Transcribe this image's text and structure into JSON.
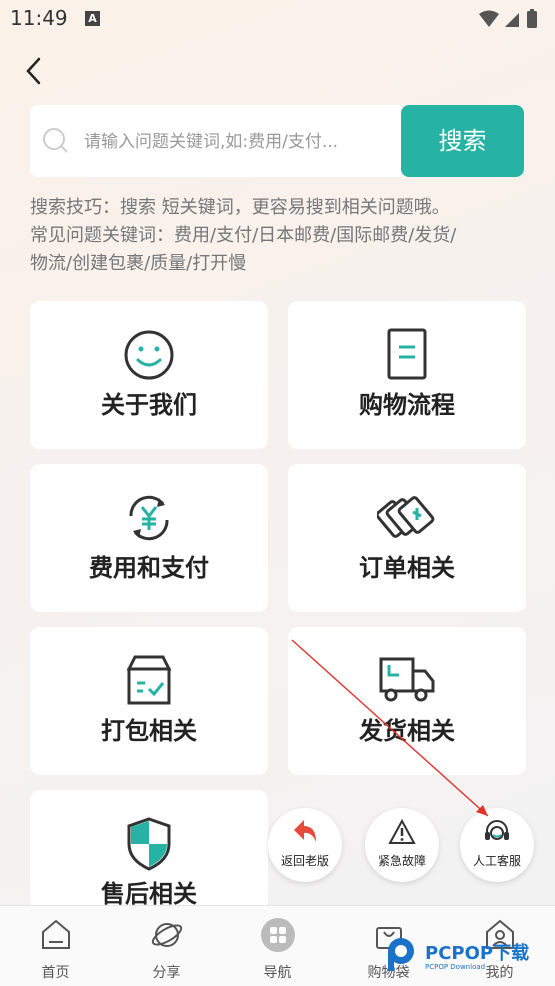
{
  "status_bar": {
    "time": "11:49",
    "notification_letter": "A"
  },
  "search": {
    "placeholder": "请输入问题关键词,如:费用/支付...",
    "button_label": "搜索"
  },
  "tips": {
    "line1": "搜索技巧：搜索 短关键词，更容易搜到相关问题哦。",
    "line2": "常见问题关键词：费用/支付/日本邮费/国际邮费/发货/",
    "line3": "物流/创建包裹/质量/打开慢"
  },
  "cards": [
    {
      "label": "关于我们",
      "icon": "smiley-icon"
    },
    {
      "label": "购物流程",
      "icon": "document-icon"
    },
    {
      "label": "费用和支付",
      "icon": "yen-refresh-icon"
    },
    {
      "label": "订单相关",
      "icon": "cards-icon"
    },
    {
      "label": "打包相关",
      "icon": "box-check-icon"
    },
    {
      "label": "发货相关",
      "icon": "truck-icon"
    },
    {
      "label": "售后相关",
      "icon": "shield-icon"
    }
  ],
  "fabs": [
    {
      "label": "返回老版",
      "icon": "undo-arrow-icon"
    },
    {
      "label": "紧急故障",
      "icon": "warning-icon"
    },
    {
      "label": "人工客服",
      "icon": "headset-icon"
    }
  ],
  "tabs": [
    {
      "label": "首页",
      "icon": "home-icon"
    },
    {
      "label": "分享",
      "icon": "planet-icon"
    },
    {
      "label": "导航",
      "icon": "grid-icon"
    },
    {
      "label": "购物袋",
      "icon": "bag-icon"
    },
    {
      "label": "我的",
      "icon": "user-icon"
    }
  ],
  "watermark": {
    "text": "PCPOP下载",
    "sub": "PCPOP Download"
  },
  "colors": {
    "accent": "#26b3a4",
    "icon_dark": "#333333",
    "annotation_arrow": "#e0322b"
  }
}
